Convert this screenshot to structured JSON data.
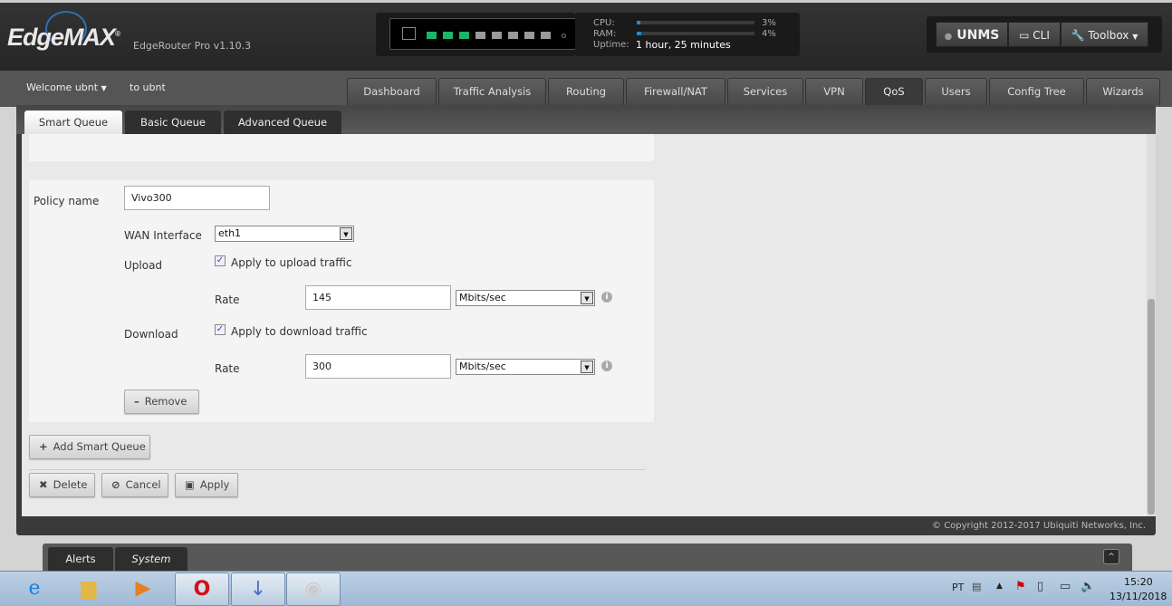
{
  "header": {
    "logo": "EdgeMAX",
    "version": "EdgeRouter Pro v1.10.3",
    "ports": [
      {
        "state": "up"
      },
      {
        "state": "up"
      },
      {
        "state": "up"
      },
      {
        "state": "down"
      },
      {
        "state": "down"
      },
      {
        "state": "down"
      },
      {
        "state": "down"
      },
      {
        "state": "down"
      }
    ],
    "stats": {
      "cpu_label": "CPU:",
      "cpu_value": "3%",
      "cpu_percent": 3,
      "ram_label": "RAM:",
      "ram_value": "4%",
      "ram_percent": 4,
      "uptime_label": "Uptime:",
      "uptime_value": "1 hour, 25 minutes"
    },
    "unms": "UNMS",
    "cli": "CLI",
    "toolbox": "Toolbox"
  },
  "user": {
    "welcome": "Welcome ubnt",
    "to": "to ubnt"
  },
  "nav": [
    "Dashboard",
    "Traffic Analysis",
    "Routing",
    "Firewall/NAT",
    "Services",
    "VPN",
    "QoS",
    "Users",
    "Config Tree",
    "Wizards"
  ],
  "subtabs": [
    "Smart Queue",
    "Basic Queue",
    "Advanced Queue"
  ],
  "form": {
    "policy_label": "Policy name",
    "policy_value": "Vivo300",
    "wan_label": "WAN Interface",
    "wan_value": "eth1",
    "upload_label": "Upload",
    "upload_check": "Apply to upload traffic",
    "upload_rate_label": "Rate",
    "upload_rate": "145",
    "upload_unit": "Mbits/sec",
    "download_label": "Download",
    "download_check": "Apply to download traffic",
    "download_rate_label": "Rate",
    "download_rate": "300",
    "download_unit": "Mbits/sec",
    "remove": "Remove"
  },
  "actions": {
    "add": "Add Smart Queue",
    "delete": "Delete",
    "cancel": "Cancel",
    "apply": "Apply"
  },
  "footer": {
    "copyright": "© Copyright 2012-2017 Ubiquiti Networks, Inc."
  },
  "bottom": {
    "alerts": "Alerts",
    "system": "System"
  },
  "taskbar": {
    "lang": "PT",
    "time": "15:20",
    "date": "13/11/2018"
  },
  "colors": {
    "port_up": "#1db36b",
    "port_down": "#9a9a9a",
    "accent": "#1b8bd1"
  }
}
